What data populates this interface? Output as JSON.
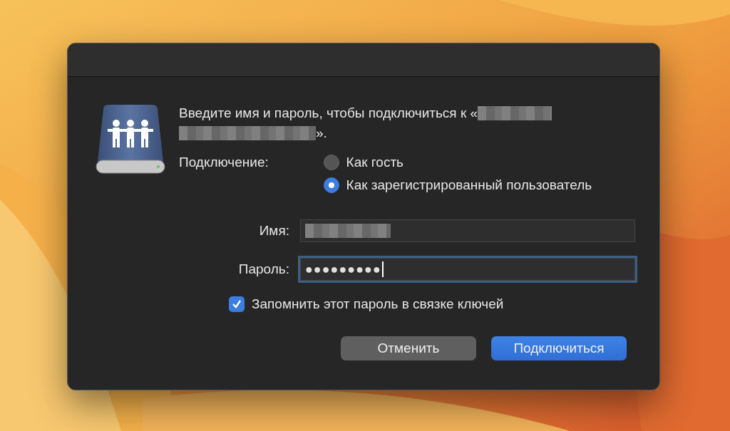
{
  "dialog": {
    "prompt": {
      "text_before": "Введите имя и пароль, чтобы подключиться к «",
      "text_after": "»."
    },
    "connection": {
      "label": "Подключение:",
      "options": [
        {
          "label": "Как гость",
          "selected": false
        },
        {
          "label": "Как зарегистрированный пользователь",
          "selected": true
        }
      ]
    },
    "fields": [
      {
        "kind": "redacted",
        "label": "Имя:",
        "focused": false
      },
      {
        "kind": "password",
        "label": "Пароль:",
        "value": "●●●●●●●●●",
        "focused": true
      }
    ],
    "remember": {
      "label": "Запомнить этот пароль в связке ключей",
      "checked": true
    },
    "buttons": [
      {
        "label": "Отменить",
        "kind": "secondary"
      },
      {
        "label": "Подключиться",
        "kind": "primary"
      }
    ]
  }
}
